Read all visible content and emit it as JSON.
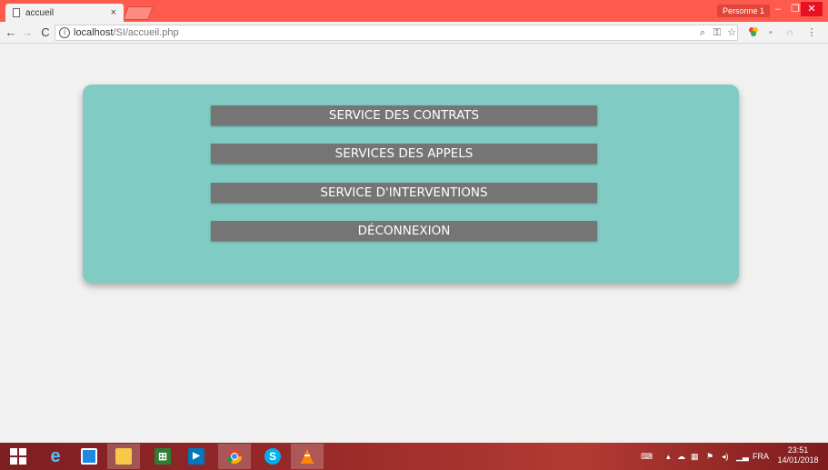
{
  "browser": {
    "tab_title": "accueil",
    "tab_close": "×",
    "profile_label": "Personne 1",
    "window_buttons": {
      "minimize": "–",
      "maximize": "❐",
      "close": "✕"
    },
    "nav": {
      "back": "←",
      "forward": "→",
      "reload": "C"
    },
    "url_host": "localhost",
    "url_path": "/SI/accueil.php",
    "info_icon_glyph": "i",
    "toolbar_icons": {
      "zoom": "⌕",
      "key": "⚿",
      "star": "☆",
      "menu": "⋮"
    }
  },
  "page": {
    "menu": [
      {
        "label": "SERVICE DES CONTRATS"
      },
      {
        "label": "SERVICES DES APPELS"
      },
      {
        "label": "SERVICE D'INTERVENTIONS"
      },
      {
        "label": "DÉCONNEXION"
      }
    ]
  },
  "taskbar": {
    "language": "FRA",
    "time": "23:51",
    "date": "14/01/2018"
  },
  "colors": {
    "card": "#80cbc4",
    "button": "#757575",
    "tab_strip": "#ff5a4e"
  }
}
